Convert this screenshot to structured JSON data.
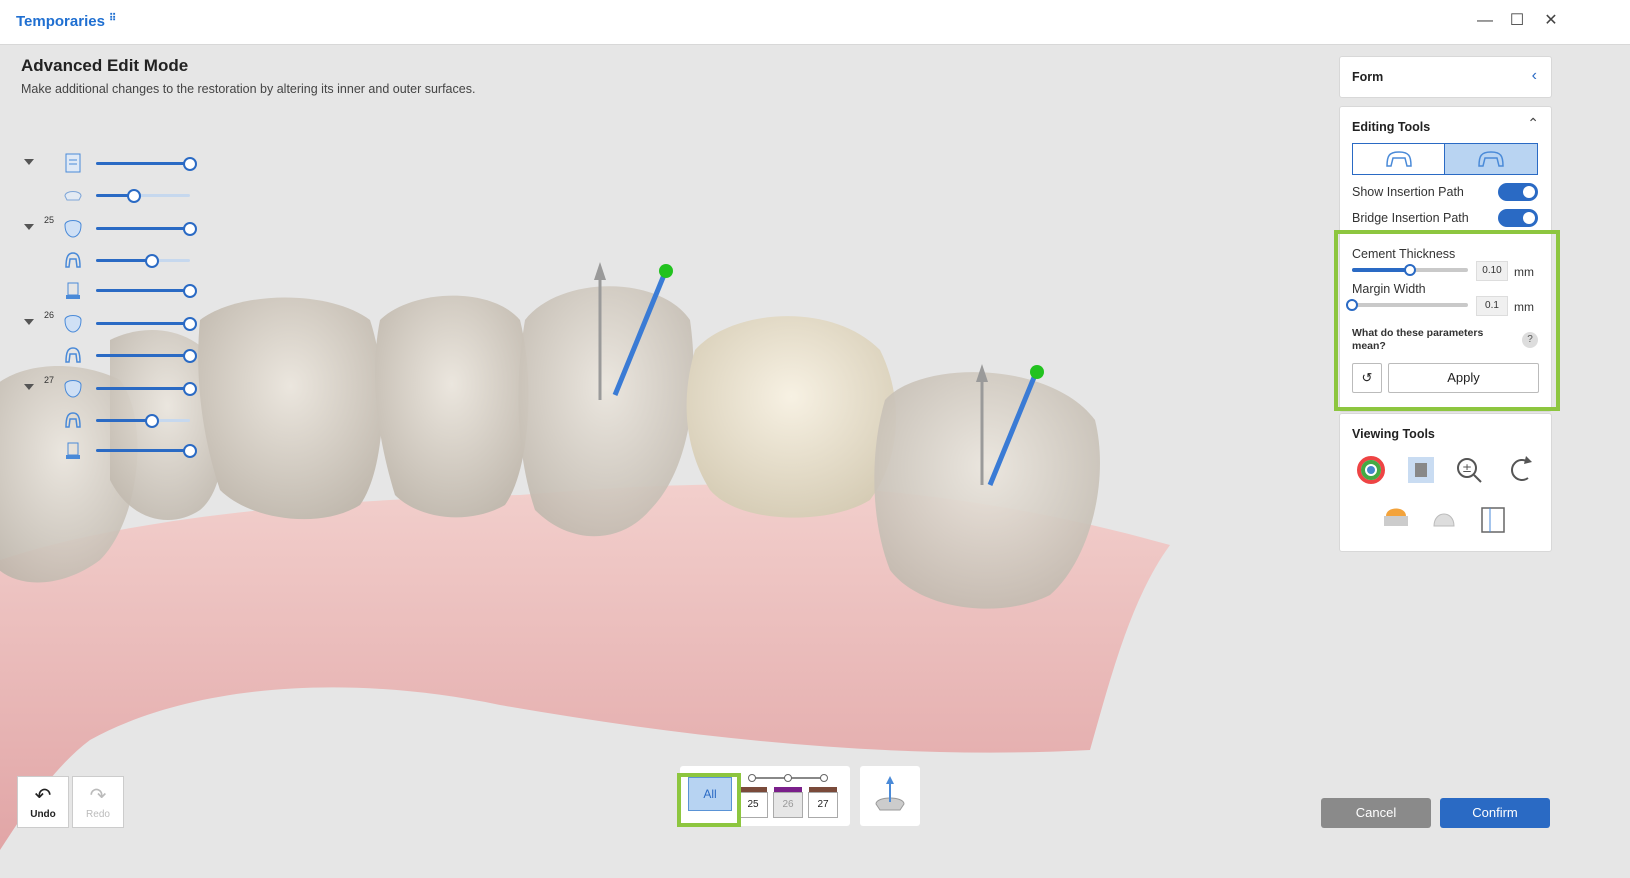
{
  "app": {
    "title": "Temporaries",
    "title_icon": "pin-icon"
  },
  "window": {
    "minimize": "—",
    "maximize": "☐",
    "close": "✕"
  },
  "mode": {
    "title": "Advanced Edit Mode",
    "subtitle": "Make additional changes to the restoration by altering its inner and outer surfaces."
  },
  "tree": [
    {
      "num": "",
      "icon": "scan-icon",
      "level": 1.0,
      "arrow": true
    },
    {
      "num": "",
      "icon": "jaw-icon",
      "level": 0.4,
      "arrow": false
    },
    {
      "num": "25",
      "icon": "tooth-crown-icon",
      "level": 1.0,
      "arrow": true
    },
    {
      "num": "",
      "icon": "tooth-inner-icon",
      "level": 0.6,
      "arrow": false
    },
    {
      "num": "",
      "icon": "abutment-icon",
      "level": 1.0,
      "arrow": false
    },
    {
      "num": "26",
      "icon": "tooth-crown-icon",
      "level": 1.0,
      "arrow": true
    },
    {
      "num": "",
      "icon": "tooth-inner-icon",
      "level": 1.0,
      "arrow": false
    },
    {
      "num": "27",
      "icon": "tooth-crown-icon",
      "level": 1.0,
      "arrow": true
    },
    {
      "num": "",
      "icon": "tooth-inner-icon",
      "level": 0.6,
      "arrow": false
    },
    {
      "num": "",
      "icon": "abutment-icon",
      "level": 1.0,
      "arrow": false
    }
  ],
  "panel": {
    "form_label": "Form",
    "editing_tools_label": "Editing Tools",
    "show_insertion_path": "Show Insertion Path",
    "bridge_insertion_path": "Bridge Insertion Path",
    "cement_thickness_label": "Cement Thickness",
    "cement_thickness_value": "0.10",
    "cement_thickness_level": 0.5,
    "margin_width_label": "Margin Width",
    "margin_width_value": "0.1",
    "margin_width_level": 0.0,
    "unit": "mm",
    "help_text": "What do these parameters mean?",
    "help_icon": "?",
    "apply_label": "Apply",
    "viewing_tools_label": "Viewing Tools"
  },
  "bottom": {
    "undo_label": "Undo",
    "redo_label": "Redo",
    "all_label": "All",
    "teeth": [
      "25",
      "26",
      "27"
    ],
    "tooth_colors": [
      "#7a4a3a",
      "#7a1f8a",
      "#7a4a3a"
    ],
    "cancel_label": "Cancel",
    "confirm_label": "Confirm"
  },
  "colors": {
    "accent": "#2a6ac4",
    "highlight": "#8dc63f",
    "gum": "#e9b4b4",
    "tooth": "#d6cfc5"
  }
}
